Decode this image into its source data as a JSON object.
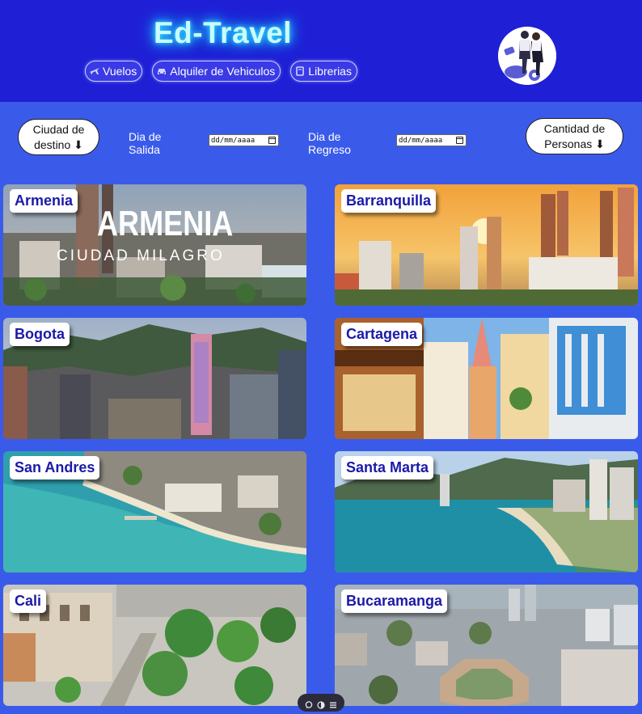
{
  "header": {
    "brand": "Ed-Travel",
    "nav": [
      {
        "label": "Vuelos",
        "icon": "plane-icon"
      },
      {
        "label": "Alquiler de Vehiculos",
        "icon": "car-icon"
      },
      {
        "label": "Librerias",
        "icon": "book-icon"
      }
    ],
    "avatar_icon": "travelers-avatar-icon"
  },
  "filters": {
    "destination_label": "Ciudad de destino ⬇",
    "departure_label": "Dia de Salida",
    "departure_placeholder": "dd/mm/aaaa",
    "return_label": "Dia de Regreso",
    "return_placeholder": "dd/mm/aaaa",
    "people_label": "Cantidad de Personas ⬇"
  },
  "cities": [
    {
      "name": "Armenia",
      "overlay_title": "ARMENIA",
      "overlay_subtitle": "CIUDAD MILAGRO"
    },
    {
      "name": "Barranquilla"
    },
    {
      "name": "Bogota"
    },
    {
      "name": "Cartagena"
    },
    {
      "name": "San Andres"
    },
    {
      "name": "Santa Marta"
    },
    {
      "name": "Cali"
    },
    {
      "name": "Bucaramanga"
    }
  ],
  "toolbar": {
    "icons": [
      "chat-icon",
      "toggle-icon",
      "menu-icon"
    ]
  },
  "colors": {
    "header_bg": "#1f1fd6",
    "page_bg": "#3a5bea",
    "label_text": "#1a1aa8",
    "brand_glow": "#2fe0ff"
  }
}
